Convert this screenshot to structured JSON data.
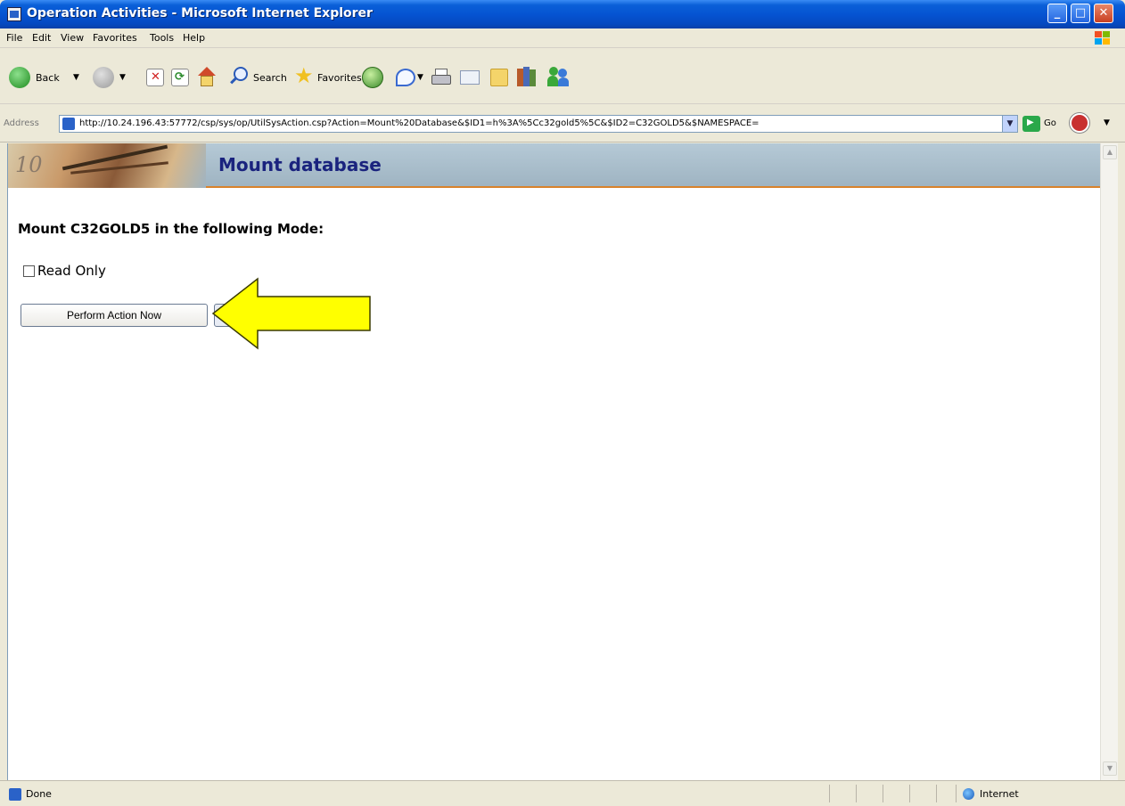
{
  "window": {
    "title": "Operation Activities - Microsoft Internet Explorer",
    "controls": {
      "minimize": "_",
      "maximize": "□",
      "close": "✕"
    }
  },
  "menu": {
    "items": [
      "File",
      "Edit",
      "View",
      "Favorites",
      "Tools",
      "Help"
    ]
  },
  "toolbar": {
    "back_label": "Back",
    "search_label": "Search",
    "favorites_label": "Favorites"
  },
  "address": {
    "label": "Address",
    "url": "http://10.24.196.43:57772/csp/sys/op/UtilSysAction.csp?Action=Mount%20Database&$ID1=h%3A%5Cc32gold5%5C&$ID2=C32GOLD5&$NAMESPACE=",
    "go_label": "Go"
  },
  "page": {
    "header_title": "Mount database",
    "art_number": "10",
    "prompt": "Mount C32GOLD5 in the following Mode:",
    "checkbox_label": "Read Only",
    "checkbox_checked": false,
    "action_button": "Perform Action Now"
  },
  "annotation": {
    "arrow_color": "#ffff00"
  },
  "status": {
    "text": "Done",
    "zone": "Internet"
  }
}
